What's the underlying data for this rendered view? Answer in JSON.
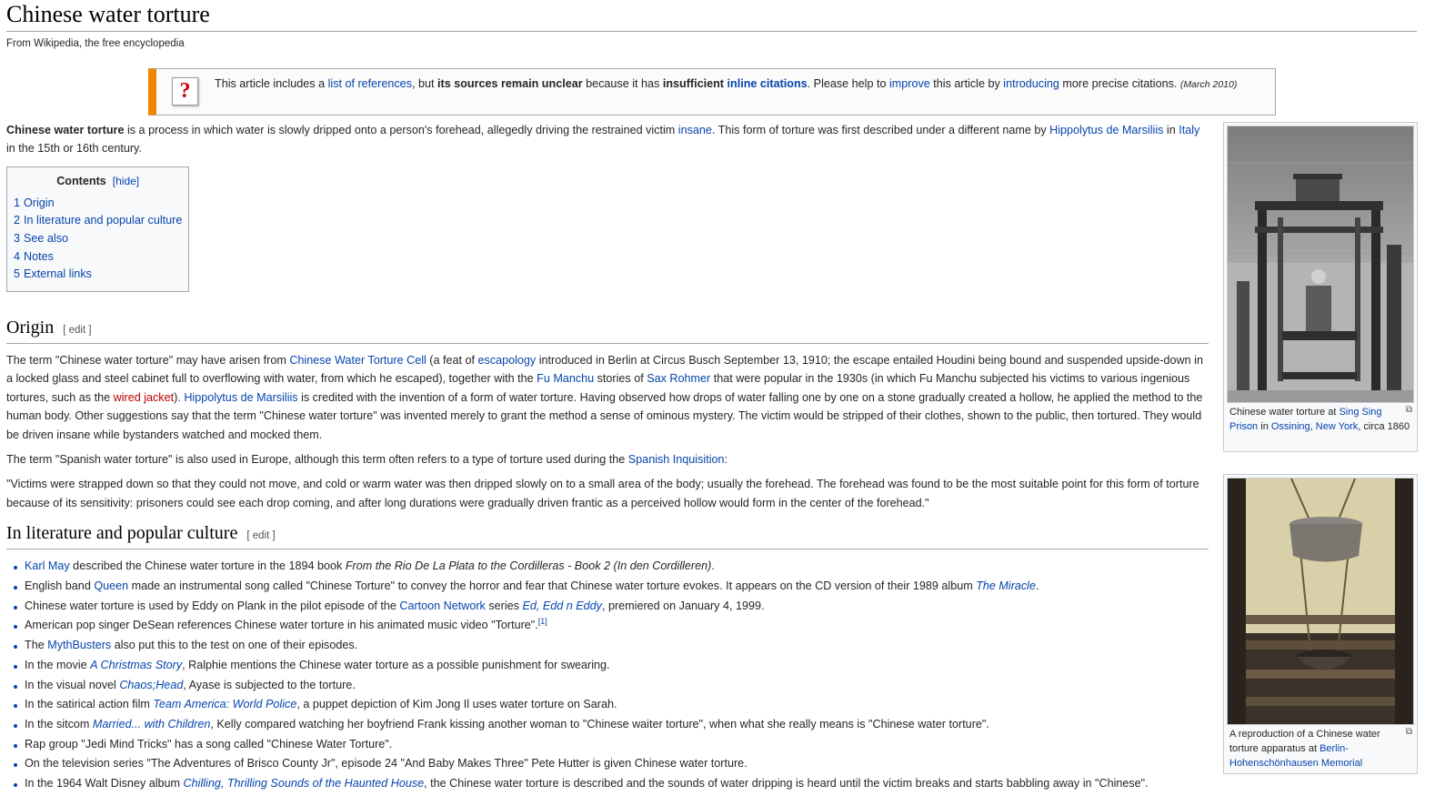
{
  "title": "Chinese water torture",
  "tagline": "From Wikipedia, the free encyclopedia",
  "ambox": {
    "icon": "?",
    "t1": "This article includes a ",
    "l1": "list of references",
    "t2": ", but ",
    "b1": "its sources remain unclear",
    "t3": " because it has ",
    "b2": "insufficient ",
    "l2": "inline citations",
    "t4": ". Please help to ",
    "l3": "improve",
    "t5": " this article by ",
    "l4": "introducing",
    "t6": " more precise citations. ",
    "date": "(March 2010)"
  },
  "intro": {
    "b": "Chinese water torture",
    "t1": " is a process in which water is slowly dripped onto a person's forehead, allegedly driving the restrained victim ",
    "l1": "insane",
    "t2": ". This form of torture was first described under a different name by ",
    "l2": "Hippolytus de Marsiliis",
    "t3": " in ",
    "l3": "Italy",
    "t4": " in the 15th or 16th century."
  },
  "toc": {
    "title": "Contents",
    "toggle": "[hide]",
    "items": [
      {
        "num": "1",
        "label": "Origin"
      },
      {
        "num": "2",
        "label": "In literature and popular culture"
      },
      {
        "num": "3",
        "label": "See also"
      },
      {
        "num": "4",
        "label": "Notes"
      },
      {
        "num": "5",
        "label": "External links"
      }
    ]
  },
  "edit_label": "[ edit ]",
  "origin": {
    "heading": "Origin",
    "p1": {
      "t1": "The term \"Chinese water torture\" may have arisen from ",
      "l1": "Chinese Water Torture Cell",
      "t2": " (a feat of ",
      "l2": "escapology",
      "t3": " introduced in Berlin at Circus Busch September 13, 1910; the escape entailed Houdini being bound and suspended upside-down in a locked glass and steel cabinet full to overflowing with water, from which he escaped), together with the ",
      "l3": "Fu Manchu",
      "t4": " stories of ",
      "l4": "Sax Rohmer",
      "t5": " that were popular in the 1930s (in which Fu Manchu subjected his victims to various ingenious tortures, such as the ",
      "l5": "wired jacket",
      "t6": "). ",
      "l6": "Hippolytus de Marsiliis",
      "t7": " is credited with the invention of a form of water torture. Having observed how drops of water falling one by one on a stone gradually created a hollow, he applied the method to the human body. Other suggestions say that the term \"Chinese water torture\" was invented merely to grant the method a sense of ominous mystery. The victim would be stripped of their clothes, shown to the public, then tortured. They would be driven insane while bystanders watched and mocked them."
    },
    "p2": {
      "t1": "The term \"Spanish water torture\" is also used in Europe, although this term often refers to a type of torture used during the ",
      "l1": "Spanish Inquisition",
      "t2": ":"
    },
    "p3": "\"Victims were strapped down so that they could not move, and cold or warm water was then dripped slowly on to a small area of the body; usually the forehead. The forehead was found to be the most suitable point for this form of torture because of its sensitivity: prisoners could see each drop coming, and after long durations were gradually driven frantic as a perceived hollow would form in the center of the forehead.\""
  },
  "culture": {
    "heading": "In literature and popular culture",
    "items": [
      {
        "a": "",
        "l1": "Karl May",
        "b": " described the Chinese water torture in the 1894 book ",
        "i": "From the Rio De La Plata to the Cordilleras - Book 2 (In den Cordilleren)",
        "c": "."
      },
      {
        "a": "English band ",
        "l1": "Queen",
        "b": " made an instrumental song called \"Chinese Torture\" to convey the horror and fear that Chinese water torture evokes. It appears on the CD version of their 1989 album ",
        "li": "The Miracle",
        "c": "."
      },
      {
        "a": "Chinese water torture is used by Eddy on Plank in the pilot episode of the ",
        "l1": "Cartoon Network",
        "b": " series ",
        "li": "Ed, Edd n Eddy",
        "c": ", premiered on January 4, 1999."
      },
      {
        "a": "American pop singer DeSean references Chinese water torture in his animated music video \"Torture\".",
        "sup": "[1]"
      },
      {
        "a": "The ",
        "l1": "MythBusters",
        "b": " also put this to the test on one of their episodes."
      },
      {
        "a": "In the movie ",
        "li": "A Christmas Story",
        "c": ", Ralphie mentions the Chinese water torture as a possible punishment for swearing."
      },
      {
        "a": "In the visual novel ",
        "li": "Chaos;Head",
        "c": ", Ayase is subjected to the torture."
      },
      {
        "a": "In the satirical action film ",
        "li": "Team America: World Police",
        "c": ", a puppet depiction of Kim Jong Il uses water torture on Sarah."
      },
      {
        "a": "In the sitcom ",
        "li": "Married... with Children",
        "c": ", Kelly compared watching her boyfriend Frank kissing another woman to \"Chinese waiter torture\", when what she really means is \"Chinese water torture\"."
      },
      {
        "a": "Rap group \"Jedi Mind Tricks\" has a song called \"Chinese Water Torture\"."
      },
      {
        "a": "On the television series \"The Adventures of Brisco County Jr\", episode 24 \"And Baby Makes Three\" Pete Hutter is given Chinese water torture."
      },
      {
        "a": "In the 1964 Walt Disney album ",
        "li": "Chilling, Thrilling Sounds of the Haunted House",
        "c": ", the Chinese water torture is described and the sounds of water dripping is heard until the victim breaks and starts babbling away in \"Chinese\"."
      }
    ]
  },
  "thumb1": {
    "t1": "Chinese water torture at ",
    "l1": "Sing Sing Prison",
    "t2": " in ",
    "l2": "Ossining",
    "t3": ", ",
    "l3": "New York",
    "t4": ", circa 1860"
  },
  "thumb2": {
    "t1": "A reproduction of a Chinese water torture apparatus at ",
    "l1": "Berlin-Hohenschönhausen Memorial"
  },
  "enlarge_glyph": "⧉",
  "colors": {
    "link": "#0645ad",
    "redlink": "#ba0000",
    "ambox_accent": "#f28500",
    "border": "#a2a9b1"
  }
}
